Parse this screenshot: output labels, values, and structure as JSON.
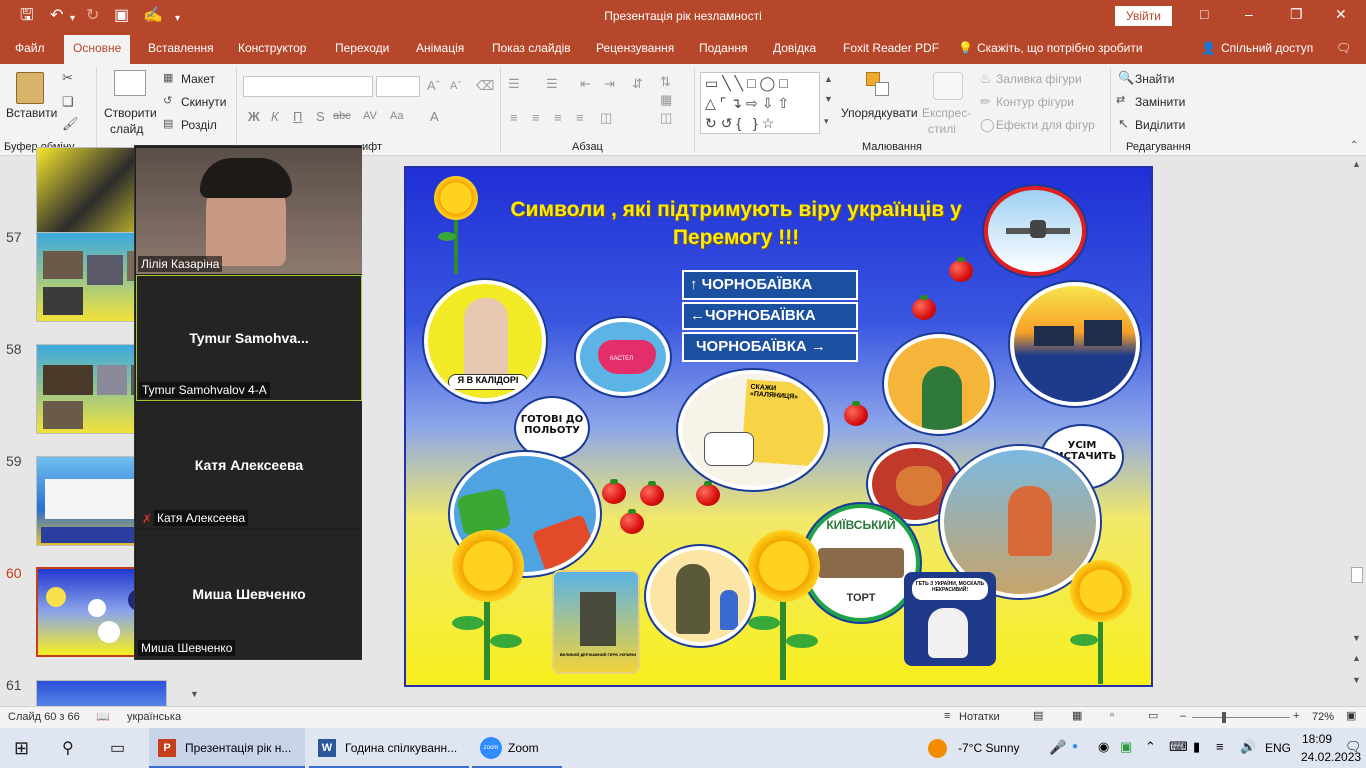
{
  "titlebar": {
    "title": "Презентація рік незламності",
    "signin": "Увійти",
    "icons": [
      "save-icon",
      "undo-icon",
      "redo-icon",
      "slideshow-icon",
      "touch-icon",
      "customize-icon"
    ]
  },
  "menu": {
    "tabs": [
      "Файл",
      "Основне",
      "Вставлення",
      "Конструктор",
      "Переходи",
      "Анімація",
      "Показ слайдів",
      "Рецензування",
      "Подання",
      "Довідка",
      "Foxit Reader PDF"
    ],
    "tellme": "Скажіть, що потрібно зробити",
    "share": "Спільний доступ"
  },
  "ribbon": {
    "paste": "Вставити",
    "clipboard_group": "Буфер обміну",
    "new_slide_1": "Створити",
    "new_slide_2": "слайд",
    "layout": "Макет",
    "reset": "Скинути",
    "section": "Розділ",
    "font_group": "ифт",
    "paragraph_group": "Абзац",
    "arrange_1": "Упорядкувати",
    "quick_styles_1": "Експрес-",
    "quick_styles_2": "стилі",
    "shape_fill": "Заливка фігури",
    "shape_outline": "Контур фігури",
    "shape_effects": "Ефекти для фігур",
    "drawing_group": "Малювання",
    "find": "Знайти",
    "replace": "Замінити",
    "select": "Виділити",
    "editing_group": "Редагування",
    "font_buttons": [
      "Ж",
      "К",
      "П",
      "S",
      "abc",
      "AV",
      "Aa",
      "A"
    ]
  },
  "slides": {
    "numbers": [
      "57",
      "58",
      "59",
      "60",
      "61"
    ],
    "active": "60"
  },
  "zoom": {
    "participants": [
      {
        "label": "Лілія Казаріна",
        "display": ""
      },
      {
        "label": "Tymur Samohvalov 4-A",
        "display": "Tymur  Samohva..."
      },
      {
        "label": "Катя Алексеева",
        "display": "Катя Алексеева"
      },
      {
        "label": "Миша Шевченко",
        "display": "Миша Шевченко"
      }
    ]
  },
  "slide": {
    "title": "Символи , які підтримують віру українців у Перемогу !!!",
    "signs": [
      "ЧОРНОБАЇВКА",
      "ЧОРНОБАЇВКА",
      "ЧОРНОБАЇВКА"
    ],
    "bubble_ready": "ГОТОВІ ДО ПОЛЬОТУ",
    "bubble_enough": "УСІМ ВИСТАЧИТЬ",
    "kalidor": "Я В КАЛІДОРІ",
    "panama_text": "КАСТЕЛ",
    "kyiv_cake_top": "КИЇВСЬКИЙ",
    "kyiv_cake_bottom": "ТОРТ",
    "dog_caption": "ГЕТЬ З УКРАЇНИ, МОСКАЛЬ НЕКРАСИВИЙ!",
    "stamp_caption": "ВЕЛИКИЙ ДЕРЖАВНИЙ ГЕРБ УКРАЇНИ",
    "palianytsia_title": "СКАЖИ «ПАЛЯНИЦЯ»"
  },
  "status": {
    "slide_count": "Слайд 60 з 66",
    "language": "українська",
    "notes": "Нотатки",
    "zoom_level": "72%"
  },
  "taskbar": {
    "apps": [
      "Презентація рік н...",
      "Година спілкуванн...",
      "Zoom"
    ],
    "weather": "-7°C  Sunny",
    "lang": "ENG",
    "time": "18:09",
    "date": "24.02.2023"
  },
  "colors": {
    "accent": "#b7472a",
    "slide_title": "#ffeb00",
    "slide_border": "#2431a8"
  }
}
